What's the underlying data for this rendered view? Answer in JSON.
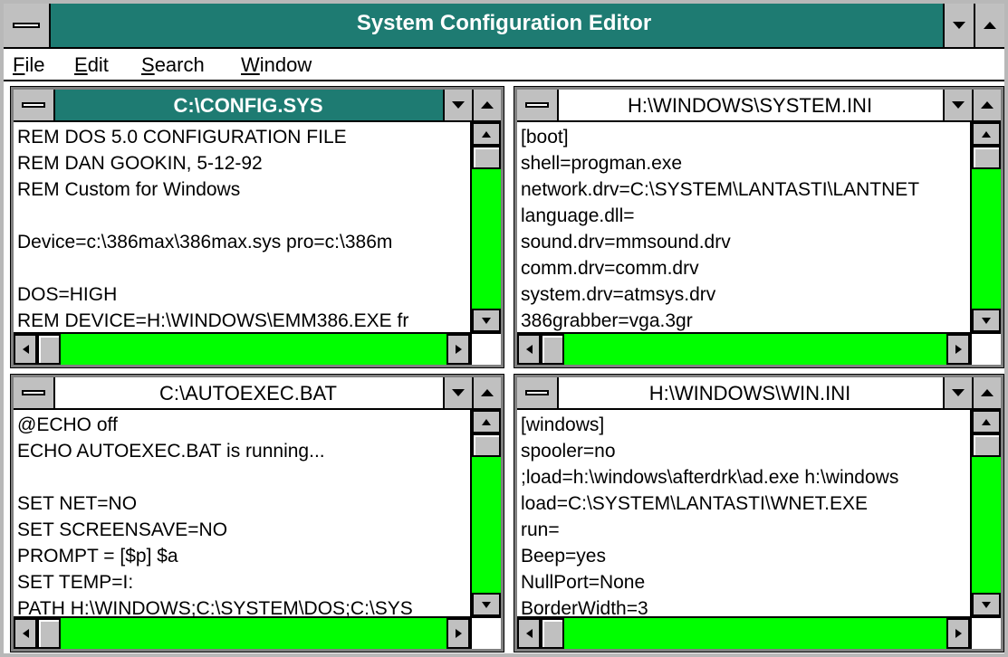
{
  "app": {
    "title": "System Configuration Editor"
  },
  "menu": {
    "file_accel": "F",
    "file_rest": "ile",
    "edit_accel": "E",
    "edit_rest": "dit",
    "search_accel": "S",
    "search_rest": "earch",
    "window_accel": "W",
    "window_rest": "indow"
  },
  "colors": {
    "title_active": "#1e7b72",
    "scrollbar_track": "#00ff00",
    "button_face": "#c0c0c0"
  },
  "windows": {
    "config": {
      "title": "C:\\CONFIG.SYS",
      "active": true,
      "lines": [
        "REM DOS 5.0 CONFIGURATION FILE",
        "REM DAN GOOKIN, 5-12-92",
        "REM Custom for Windows",
        "",
        "Device=c:\\386max\\386max.sys pro=c:\\386m",
        "",
        "DOS=HIGH",
        "REM DEVICE=H:\\WINDOWS\\EMM386.EXE fr"
      ]
    },
    "system_ini": {
      "title": "H:\\WINDOWS\\SYSTEM.INI",
      "active": false,
      "lines": [
        "[boot]",
        "shell=progman.exe",
        "network.drv=C:\\SYSTEM\\LANTASTI\\LANTNET",
        "language.dll=",
        "sound.drv=mmsound.drv",
        "comm.drv=comm.drv",
        "system.drv=atmsys.drv",
        "386grabber=vga.3gr"
      ]
    },
    "autoexec": {
      "title": "C:\\AUTOEXEC.BAT",
      "active": false,
      "lines": [
        "@ECHO off",
        "ECHO AUTOEXEC.BAT is running...",
        "",
        "SET NET=NO",
        "SET SCREENSAVE=NO",
        "PROMPT = [$p] $a",
        "SET TEMP=I:",
        "PATH H:\\WINDOWS;C:\\SYSTEM\\DOS;C:\\SYS"
      ]
    },
    "win_ini": {
      "title": "H:\\WINDOWS\\WIN.INI",
      "active": false,
      "lines": [
        "[windows]",
        "spooler=no",
        ";load=h:\\windows\\afterdrk\\ad.exe h:\\windows",
        "load=C:\\SYSTEM\\LANTASTI\\WNET.EXE",
        "run=",
        "Beep=yes",
        "NullPort=None",
        "BorderWidth=3"
      ]
    }
  }
}
